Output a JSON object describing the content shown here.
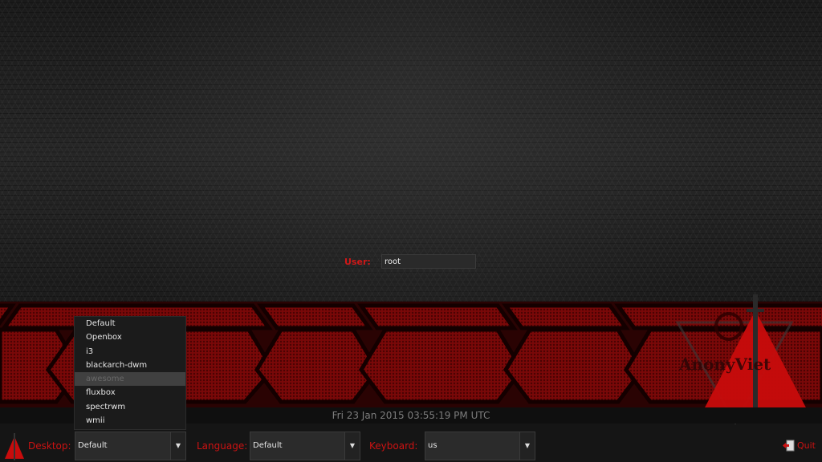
{
  "login": {
    "user_label": "User:",
    "user_value": "root"
  },
  "datetime": "Fri 23 Jan 2015 03:55:19 PM UTC",
  "desktop": {
    "label": "Desktop:",
    "value": "Default",
    "options": [
      "Default",
      "Openbox",
      "i3",
      "blackarch-dwm",
      "awesome",
      "fluxbox",
      "spectrwm",
      "wmii"
    ],
    "highlighted": "awesome"
  },
  "language": {
    "label": "Language:",
    "value": "Default"
  },
  "keyboard": {
    "label": "Keyboard:",
    "value": "us"
  },
  "quit": {
    "label": "Quit"
  },
  "brand": {
    "text": "AnonyViet"
  },
  "icons": {
    "dropdown_arrow": "▼"
  },
  "colors": {
    "accent": "#cc1212",
    "banner": "#8a0a0a",
    "background": "#151515"
  }
}
